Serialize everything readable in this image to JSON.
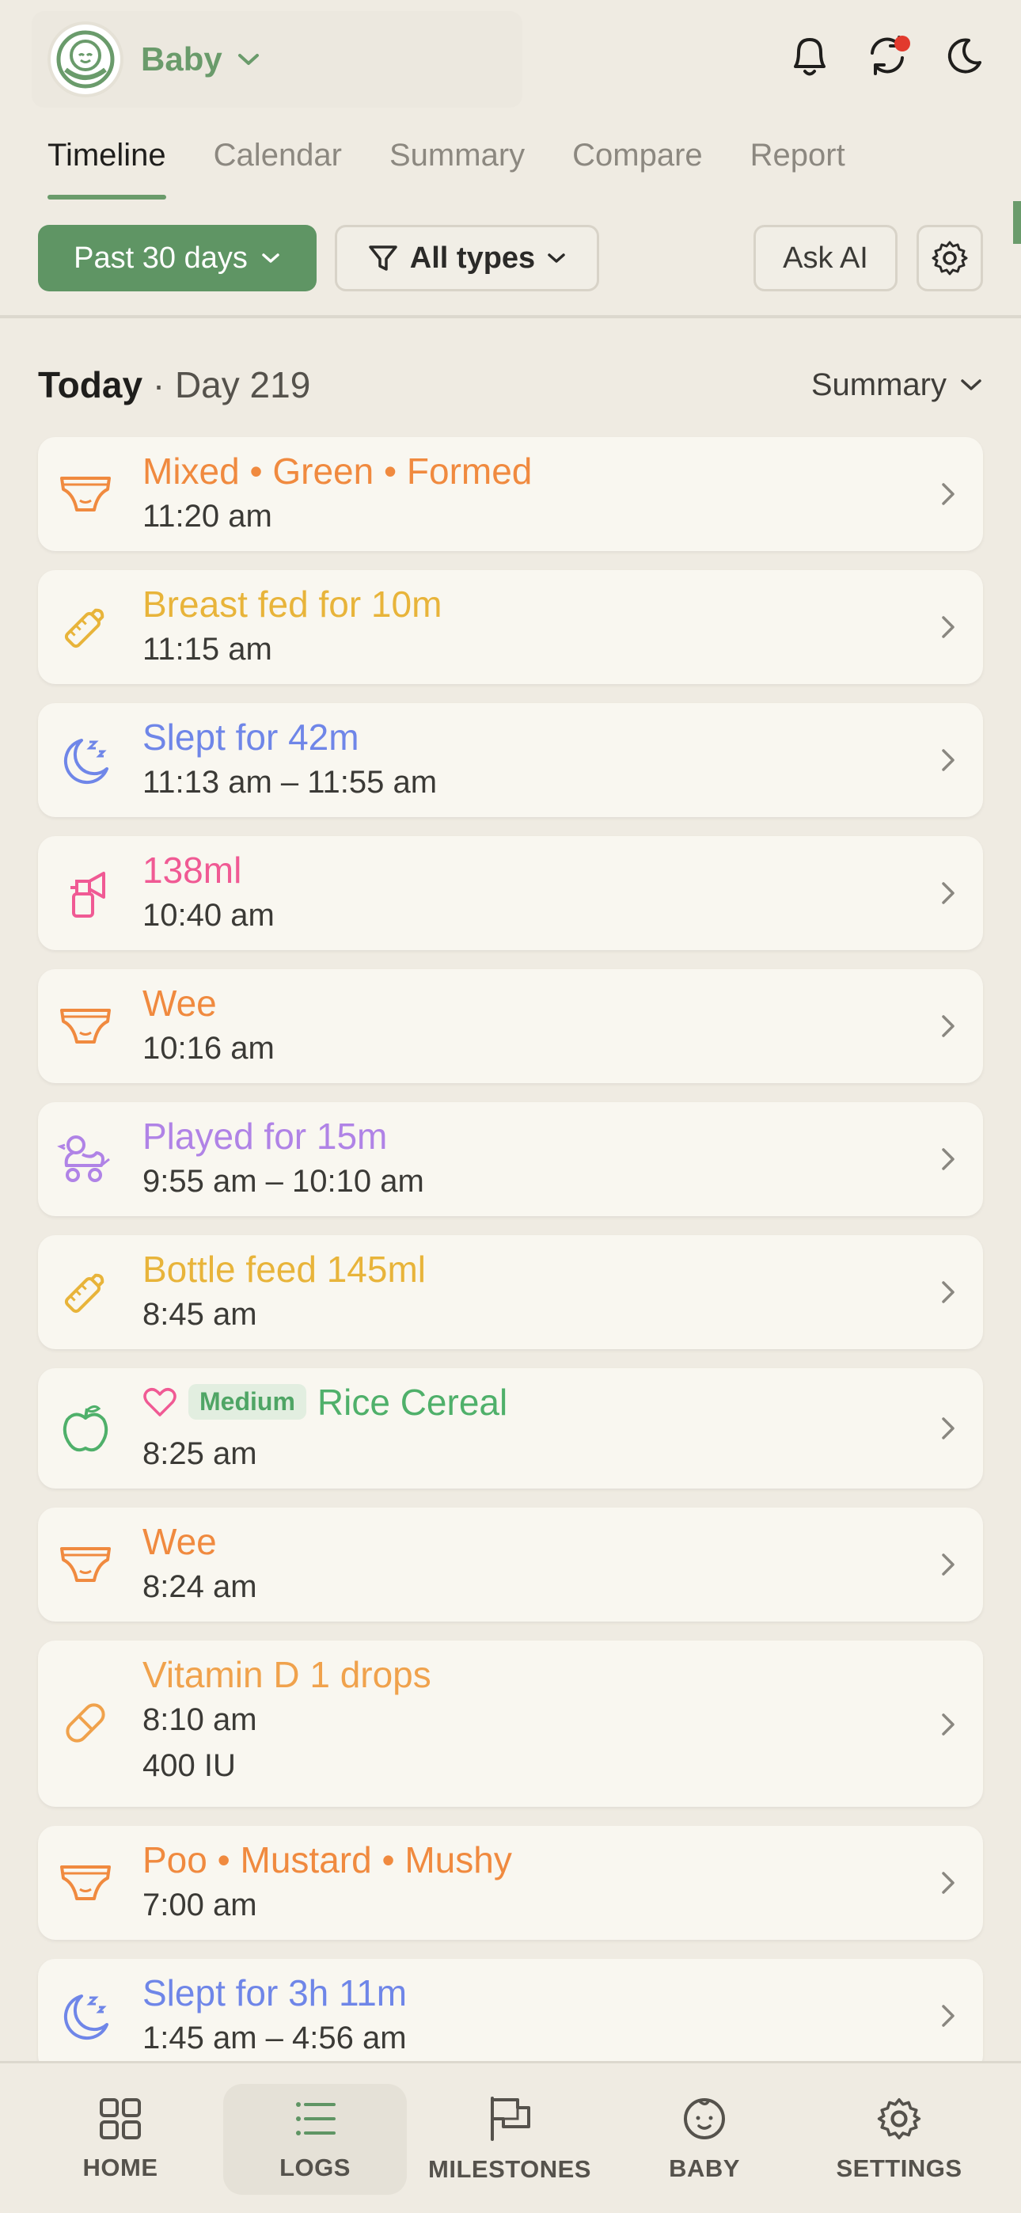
{
  "header": {
    "baby_name": "Baby",
    "colors": {
      "brand": "#6a9b6b",
      "notification_dot": "#e23a2d"
    }
  },
  "tabs": [
    {
      "label": "Timeline",
      "active": true
    },
    {
      "label": "Calendar",
      "active": false
    },
    {
      "label": "Summary",
      "active": false
    },
    {
      "label": "Compare",
      "active": false
    },
    {
      "label": "Report",
      "active": false
    }
  ],
  "filters": {
    "range_label": "Past 30 days",
    "types_label": "All types",
    "ask_ai_label": "Ask AI"
  },
  "section": {
    "today_label": "Today",
    "day_label": "· Day 219",
    "summary_label": "Summary"
  },
  "entries": [
    {
      "icon": "diaper-icon",
      "title": "Mixed • Green • Formed",
      "time": "11:20 am",
      "color": "#f08a3f"
    },
    {
      "icon": "bottle-icon",
      "title": "Breast fed for 10m",
      "time": "11:15 am",
      "color": "#e8b43a"
    },
    {
      "icon": "moon-sleep-icon",
      "title": "Slept for 42m",
      "time": "11:13 am – 11:55 am",
      "color": "#6f86e8"
    },
    {
      "icon": "breast-pump-icon",
      "title": "138ml",
      "time": "10:40 am",
      "color": "#f05a94"
    },
    {
      "icon": "diaper-icon",
      "title": "Wee",
      "time": "10:16 am",
      "color": "#f08a3f"
    },
    {
      "icon": "toy-duck-icon",
      "title": "Played for 15m",
      "time": "9:55 am – 10:10 am",
      "color": "#b083e6"
    },
    {
      "icon": "bottle-icon",
      "title": "Bottle feed 145ml",
      "time": "8:45 am",
      "color": "#e8b43a"
    },
    {
      "icon": "apple-icon",
      "title": "Rice Cereal",
      "badge": "Medium",
      "time": "8:25 am",
      "color": "#4fb06a"
    },
    {
      "icon": "diaper-icon",
      "title": "Wee",
      "time": "8:24 am",
      "color": "#f08a3f"
    },
    {
      "icon": "pill-icon",
      "title": "Vitamin D 1 drops",
      "time": "8:10 am",
      "extra": "400 IU",
      "color": "#f0a24c"
    },
    {
      "icon": "diaper-icon",
      "title": "Poo • Mustard • Mushy",
      "time": "7:00 am",
      "color": "#f08a3f"
    },
    {
      "icon": "moon-sleep-icon",
      "title": "Slept for 3h 11m",
      "time": "1:45 am – 4:56 am",
      "color": "#6f86e8"
    }
  ],
  "bottom_nav": [
    {
      "label": "HOME",
      "icon": "grid-icon",
      "active": false
    },
    {
      "label": "LOGS",
      "icon": "list-icon",
      "active": true
    },
    {
      "label": "MILESTONES",
      "icon": "flag-icon",
      "active": false
    },
    {
      "label": "BABY",
      "icon": "baby-face-icon",
      "active": false
    },
    {
      "label": "SETTINGS",
      "icon": "gear-icon",
      "active": false
    }
  ]
}
